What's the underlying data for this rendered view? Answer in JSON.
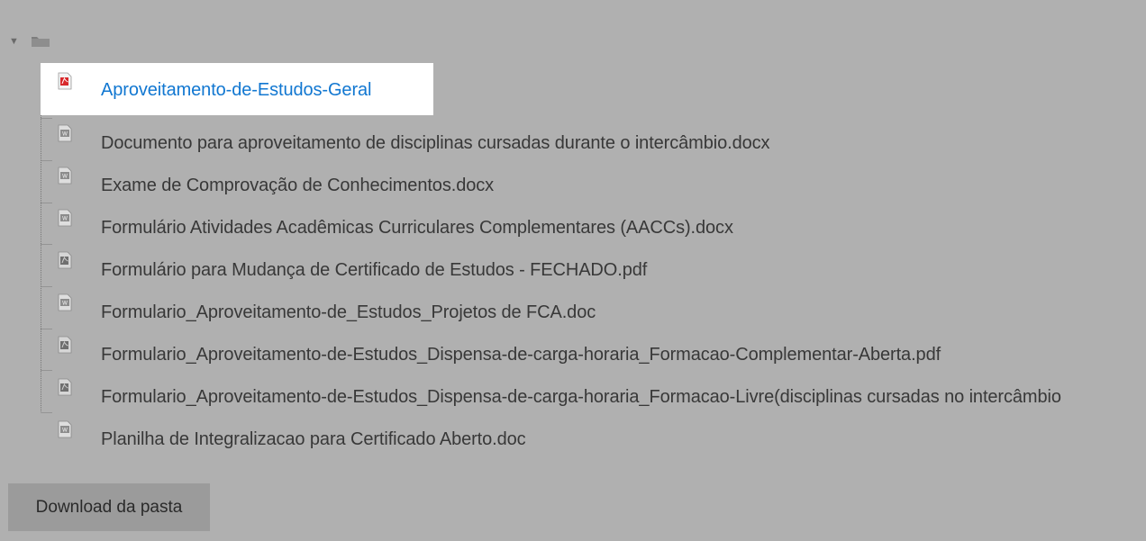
{
  "tree": {
    "twisty_glyph": "▼",
    "folder_icon": "folder-icon",
    "files": [
      {
        "name": "Aproveitamento-de-Estudos-Geral",
        "icon": "pdf-icon",
        "highlighted": true
      },
      {
        "name": "Documento para aproveitamento de disciplinas cursadas durante o intercâmbio.docx",
        "icon": "word-document-icon"
      },
      {
        "name": "Exame de Comprovação de Conhecimentos.docx",
        "icon": "word-document-icon"
      },
      {
        "name": "Formulário Atividades Acadêmicas Curriculares Complementares (AACCs).docx",
        "icon": "word-document-icon"
      },
      {
        "name": "Formulário para Mudança de Certificado de Estudos - FECHADO.pdf",
        "icon": "pdf-icon"
      },
      {
        "name": "Formulario_Aproveitamento-de_Estudos_Projetos de FCA.doc",
        "icon": "word-document-icon"
      },
      {
        "name": "Formulario_Aproveitamento-de-Estudos_Dispensa-de-carga-horaria_Formacao-Complementar-Aberta.pdf",
        "icon": "pdf-icon"
      },
      {
        "name": "Formulario_Aproveitamento-de-Estudos_Dispensa-de-carga-horaria_Formacao-Livre(disciplinas cursadas no intercâmbio",
        "icon": "pdf-icon"
      },
      {
        "name": "Planilha de Integralizacao para Certificado Aberto.doc",
        "icon": "word-document-icon"
      }
    ]
  },
  "download": {
    "label": "Download da pasta"
  },
  "colors": {
    "background": "#b0b0b0",
    "link": "#1177d1",
    "text": "#383838",
    "button": "#9b9b9b"
  }
}
